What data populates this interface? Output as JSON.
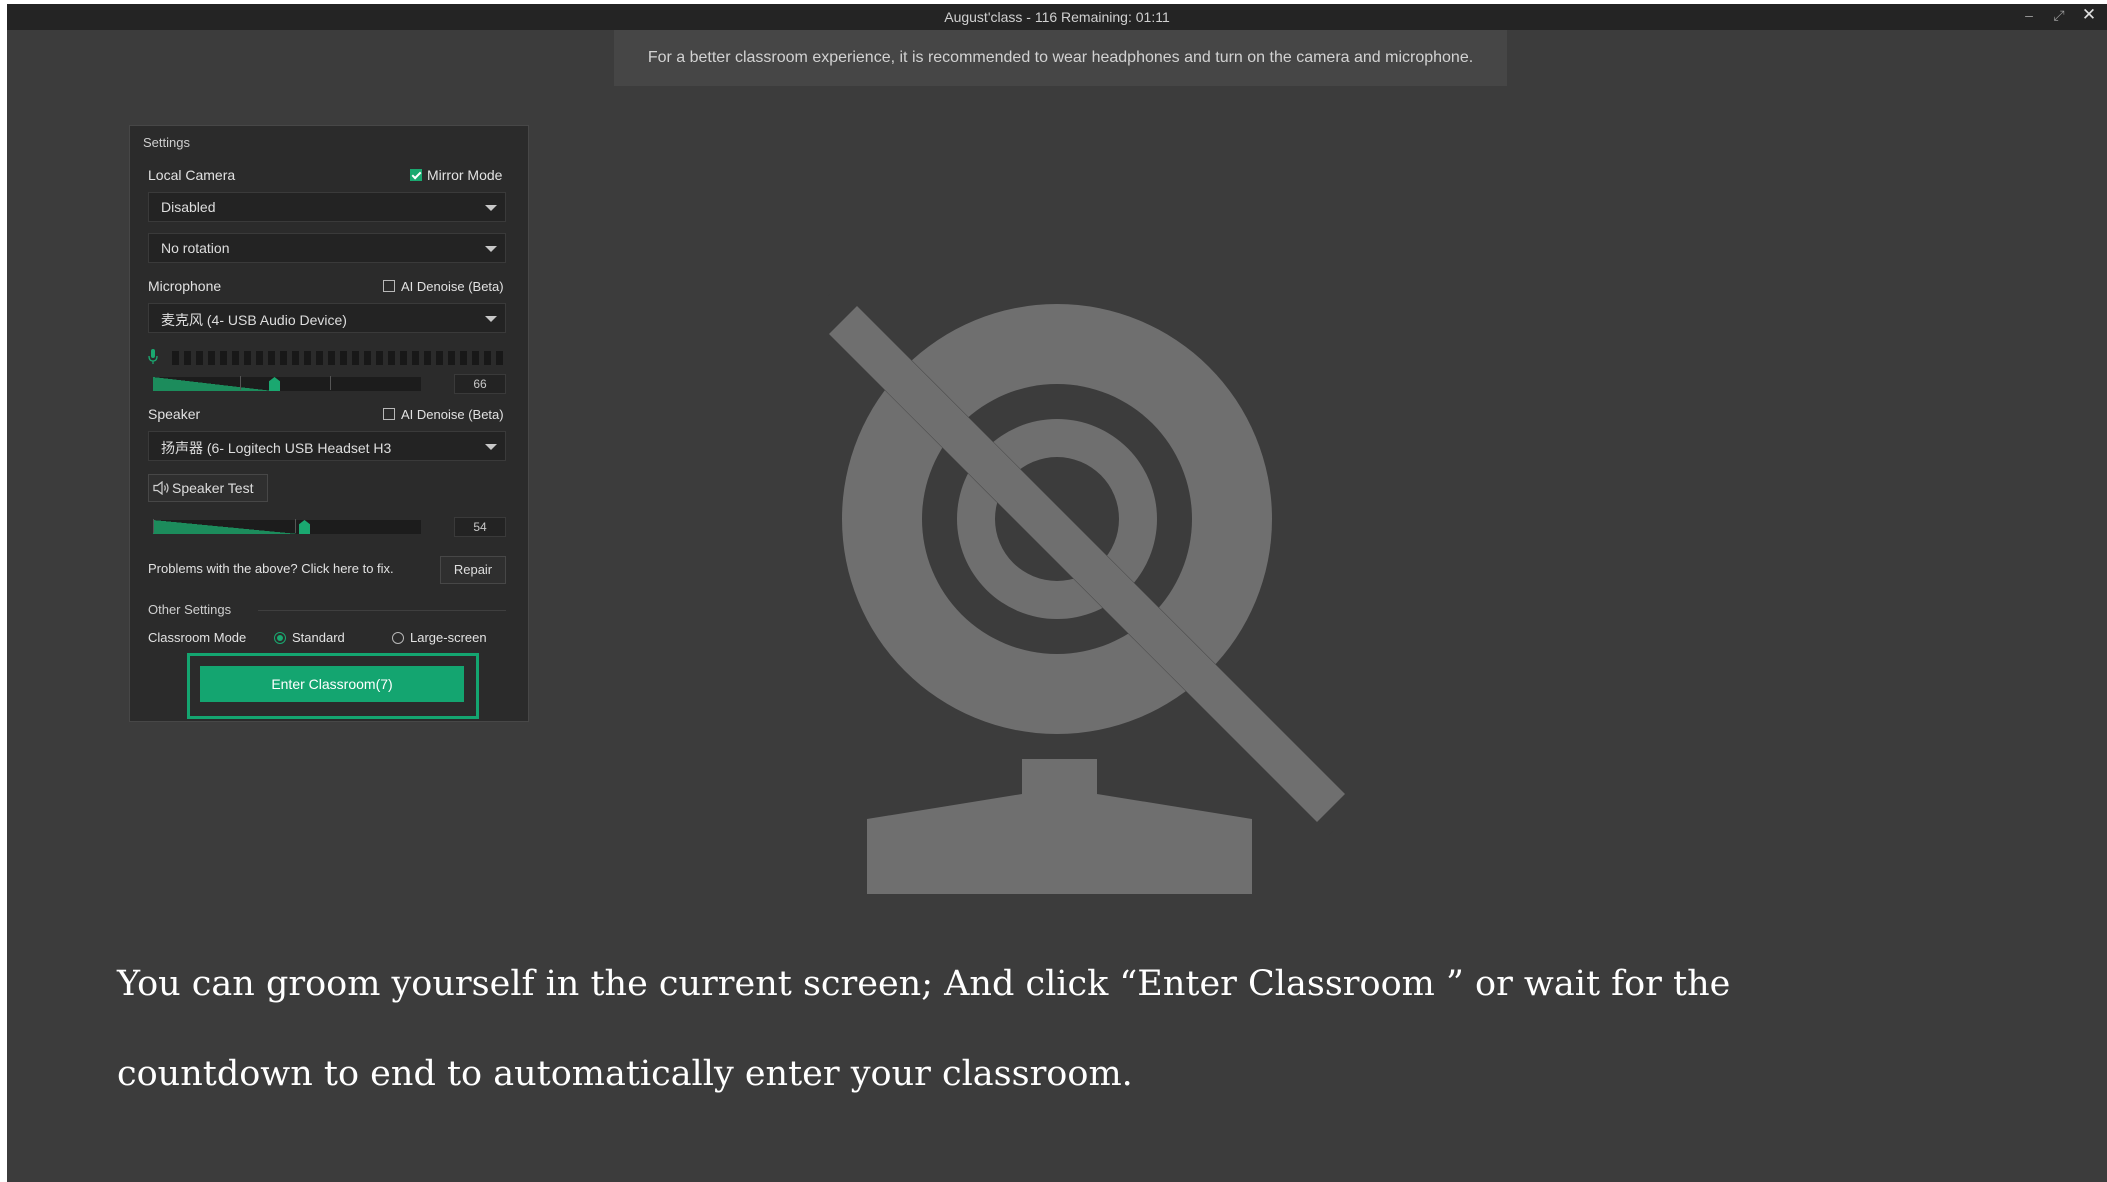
{
  "window": {
    "title": "August'class - 116   Remaining: 01:11",
    "controls": [
      "minimize",
      "restore",
      "close"
    ]
  },
  "tip": "For a better classroom experience, it is recommended to wear headphones and turn on the camera and microphone.",
  "settings": {
    "title": "Settings",
    "camera": {
      "label": "Local Camera",
      "mirror_label": "Mirror Mode",
      "mirror_checked": true,
      "device": "Disabled",
      "rotation": "No rotation"
    },
    "microphone": {
      "label": "Microphone",
      "denoise_label": "AI Denoise (Beta)",
      "denoise_checked": false,
      "device": "麦克风 (4- USB Audio Device)",
      "volume": "66"
    },
    "speaker": {
      "label": "Speaker",
      "denoise_label": "AI Denoise (Beta)",
      "denoise_checked": false,
      "device": "扬声器 (6- Logitech USB Headset H3",
      "test_label": "Speaker Test",
      "volume": "54"
    },
    "repair": {
      "text": "Problems with the above? Click here to fix.",
      "button": "Repair"
    },
    "other": {
      "title": "Other Settings",
      "mode_label": "Classroom Mode",
      "options": [
        "Standard",
        "Large-screen"
      ],
      "selected": "Standard"
    },
    "enter_button": "Enter Classroom(7)"
  },
  "preview": {
    "icon": "camera-off-icon",
    "color": "#6f6f6f"
  },
  "caption": {
    "line1": "You can groom yourself in the current screen; And click “Enter Classroom ” or wait for the",
    "line2": "countdown to end to automatically enter your classroom."
  },
  "colors": {
    "accent": "#14a570",
    "background": "#3c3c3c",
    "titlebar": "#242424",
    "panel": "#2b2b2b"
  }
}
